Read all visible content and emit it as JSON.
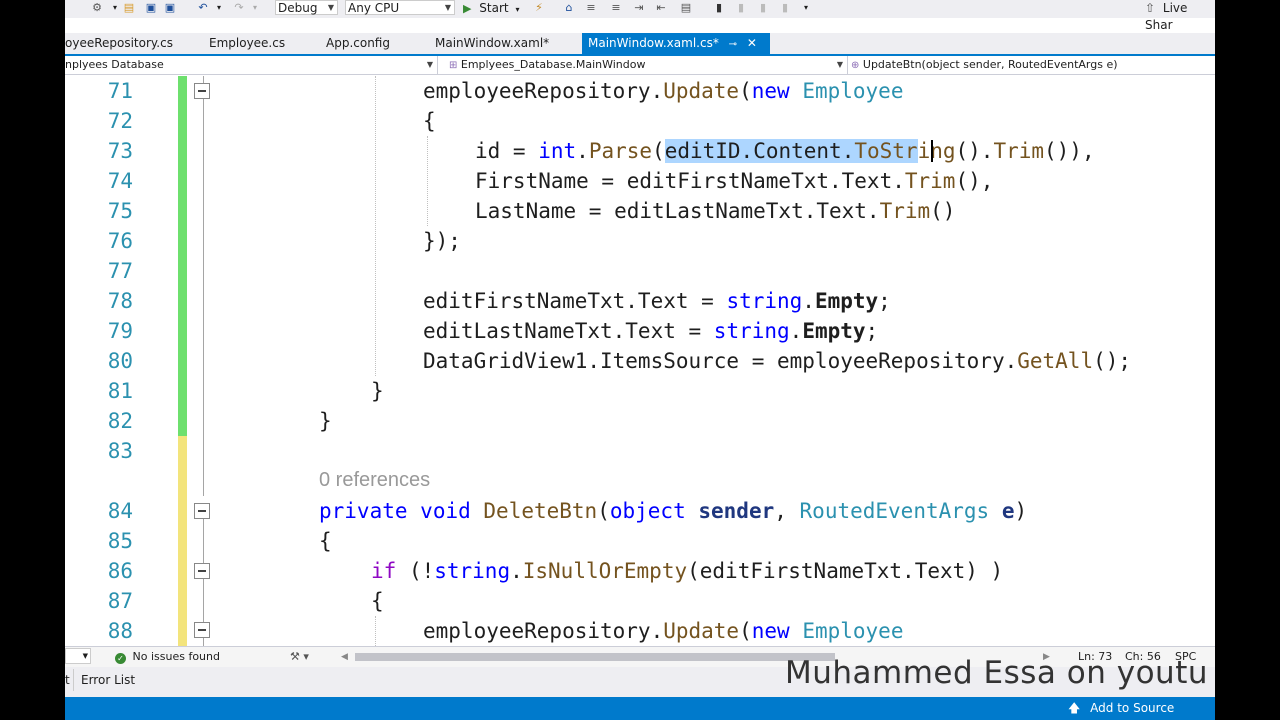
{
  "toolbar": {
    "config": "Debug",
    "platform": "Any CPU",
    "start_label": "Start",
    "live_share": "Live Shar"
  },
  "tabs": [
    {
      "label": "oyeeRepository.cs"
    },
    {
      "label": "Employee.cs"
    },
    {
      "label": "App.config"
    },
    {
      "label": "MainWindow.xaml*"
    },
    {
      "label": "MainWindow.xaml.cs*"
    }
  ],
  "navbar": {
    "project": "nplyees Database",
    "class": "Emplyees_Database.MainWindow",
    "member": "UpdateBtn(object sender, RoutedEventArgs e)"
  },
  "line_numbers": [
    "71",
    "72",
    "73",
    "74",
    "75",
    "76",
    "77",
    "78",
    "79",
    "80",
    "81",
    "82",
    "83",
    "84",
    "85",
    "86",
    "87",
    "88"
  ],
  "codelens": "0 references",
  "status": {
    "issues": "No issues found",
    "ln": "Ln: 73",
    "ch": "Ch: 56",
    "mode": "SPC"
  },
  "error_list": "Error List",
  "source_control": "Add to Source Control",
  "watermark": "Muhammed Essa on youtu",
  "colors": {
    "accent": "#007acc",
    "change_saved": "#6ee06e",
    "change_unsaved": "#f3e47c",
    "line_number": "#2b91af",
    "keyword": "#0000ff",
    "type": "#2b91af",
    "method": "#74531f",
    "control": "#8f08c4",
    "selection": "#add6ff"
  }
}
